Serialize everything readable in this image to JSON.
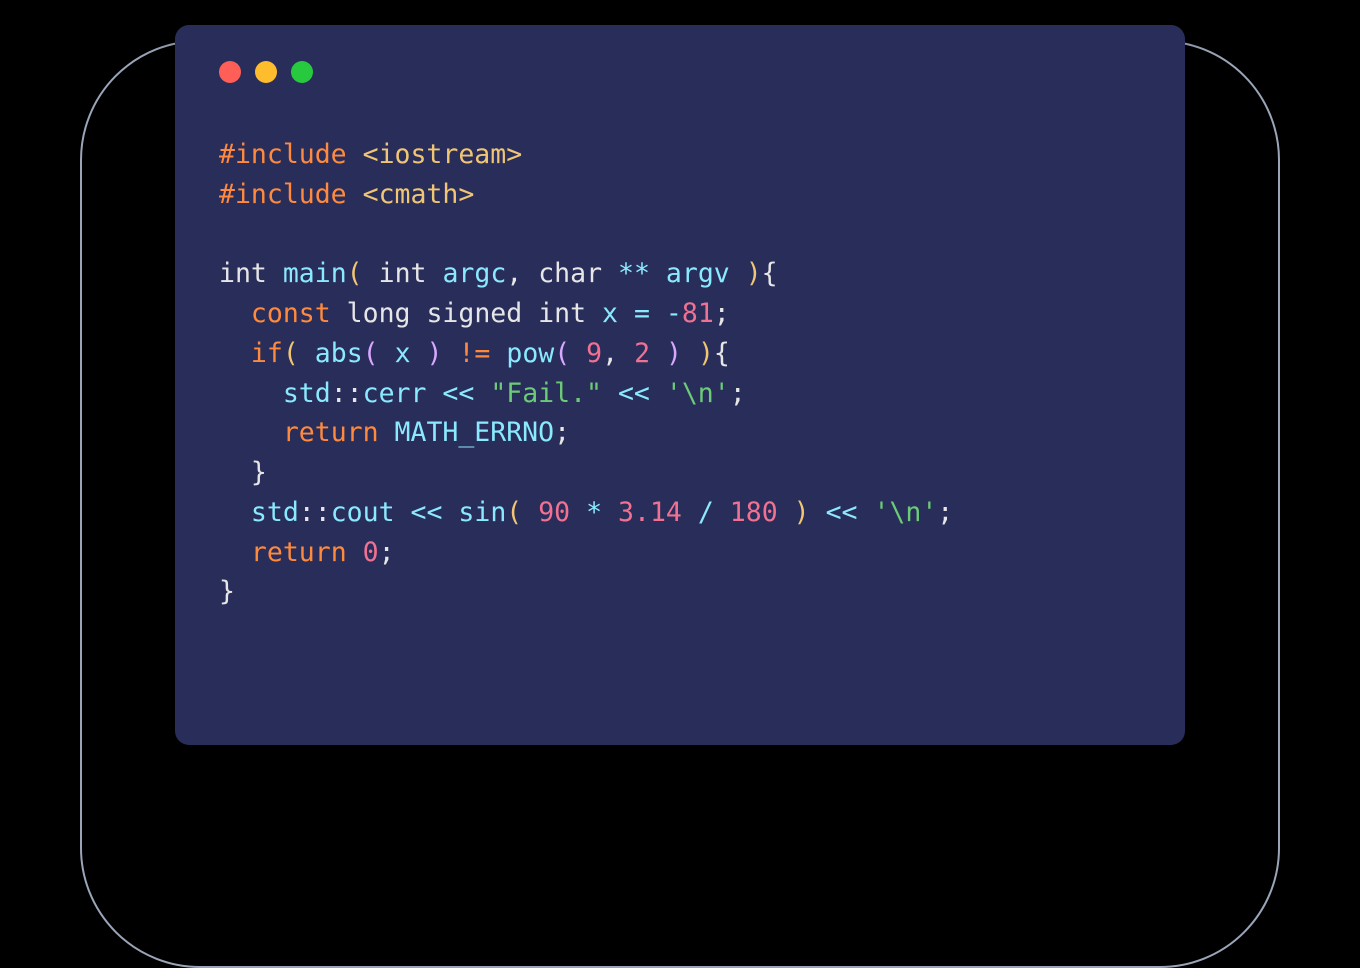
{
  "window": {
    "traffic": {
      "red": "#FF5F56",
      "yellow": "#FFBD2E",
      "green": "#27C93F"
    }
  },
  "code": {
    "l1_inc": "#include",
    "l1_hdr": "<iostream>",
    "l2_inc": "#include",
    "l2_hdr": "<cmath>",
    "l3_int": "int",
    "l3_main": "main",
    "l3_int2": "int",
    "l3_argc": "argc",
    "l3_char": "char",
    "l3_stars": "**",
    "l3_argv": "argv",
    "l4_const": "const",
    "l4_long": "long",
    "l4_signed": "signed",
    "l4_int": "int",
    "l4_x": "x",
    "l4_eq": "=",
    "l4_neg": "-",
    "l4_val": "81",
    "l5_if": "if",
    "l5_abs": "abs",
    "l5_x": "x",
    "l5_neq": "!=",
    "l5_pow": "pow",
    "l5_9": "9",
    "l5_2": "2",
    "l6_std": "std",
    "l6_sep": "::",
    "l6_cerr": "cerr",
    "l6_shl1": "<<",
    "l6_fail": "\"Fail.\"",
    "l6_shl2": "<<",
    "l6_nl": "'\\n'",
    "l7_return": "return",
    "l7_errno": "MATH_ERRNO",
    "l9_std": "std",
    "l9_sep": "::",
    "l9_cout": "cout",
    "l9_shl1": "<<",
    "l9_sin": "sin",
    "l9_90": "90",
    "l9_star": "*",
    "l9_pi": "3.14",
    "l9_slash": "/",
    "l9_180": "180",
    "l9_shl2": "<<",
    "l9_nl": "'\\n'",
    "l10_return": "return",
    "l10_zero": "0"
  }
}
